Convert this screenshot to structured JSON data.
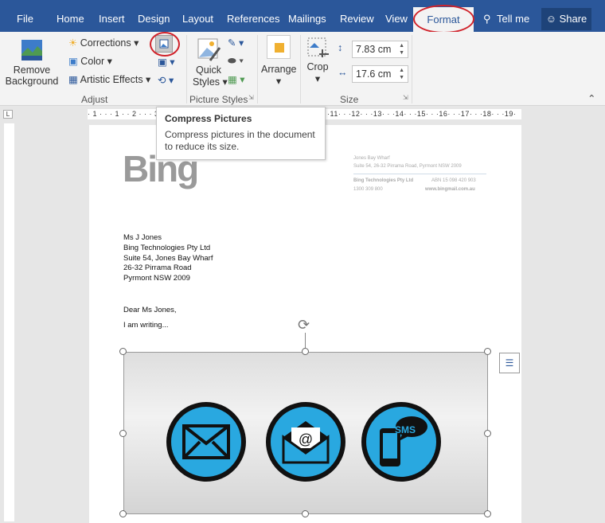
{
  "tabs": {
    "file": "File",
    "home": "Home",
    "insert": "Insert",
    "design": "Design",
    "layout": "Layout",
    "references": "References",
    "mailings": "Mailings",
    "review": "Review",
    "view": "View",
    "format": "Format",
    "tell_me": "Tell me",
    "share": "Share"
  },
  "ribbon": {
    "adjust": {
      "remove_background": [
        "Remove",
        "Background"
      ],
      "corrections": "Corrections",
      "color": "Color",
      "artistic_effects": "Artistic Effects",
      "label": "Adjust"
    },
    "picture_styles": {
      "quick_styles": [
        "Quick",
        "Styles"
      ],
      "label": "Picture Styles"
    },
    "arrange": {
      "label": "Arrange"
    },
    "size": {
      "crop": "Crop",
      "height": "7.83 cm",
      "width": "17.6 cm",
      "label": "Size"
    }
  },
  "ruler": {
    "text": "· 1 · · · 1 · · 2 · · · 3 · · · 4 · · · 5 · · · 6 · · · 7 · · · 8 · · · 9 · · ·10· · ·11· · ·12· · ·13· · ·14· · ·15· · ·16· · ·17· · ·18· · ·19·"
  },
  "tooltip": {
    "title": "Compress Pictures",
    "body": "Compress pictures in the document to reduce its size."
  },
  "document": {
    "logo": "Bing",
    "header": {
      "line1": "Jones Bay Wharf",
      "line2": "Suite 54, 26-32 Pirrama Road, Pyrmont NSW 2009",
      "company": "Bing Technologies Pty Ltd",
      "abn": "ABN 15 098 420 903",
      "phone": "1300 309 800",
      "web": "www.bingmail.com.au"
    },
    "address": [
      "Ms J Jones",
      "Bing Technologies Pty Ltd",
      "Suite 54, Jones Bay Wharf",
      "26-32 Pirrama Road",
      "Pyrmont NSW 2009"
    ],
    "salutation": "Dear Ms Jones,",
    "body": "I am writing...",
    "sms_label": "SMS"
  },
  "colors": {
    "accent": "#2b579a",
    "highlight": "#d0222a",
    "icon_blue": "#29a8e0"
  }
}
